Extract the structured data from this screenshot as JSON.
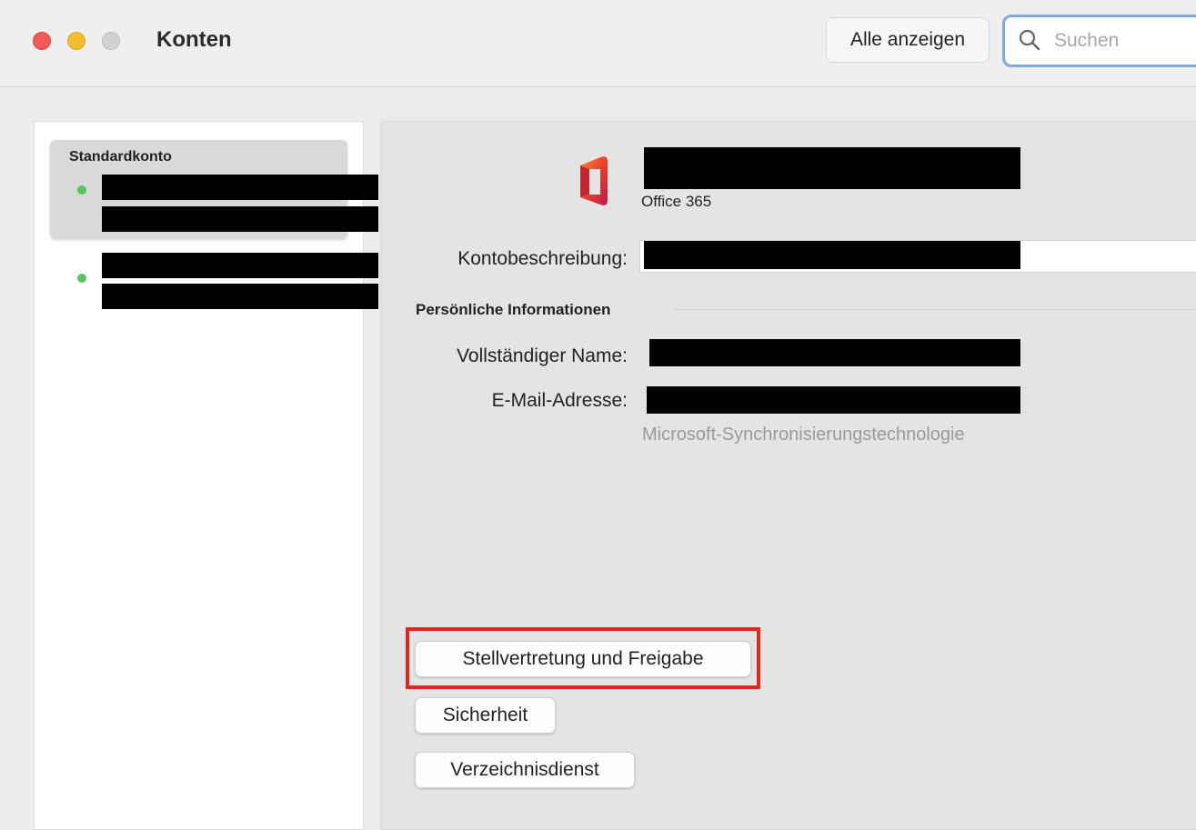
{
  "window": {
    "title": "Konten",
    "show_all_label": "Alle anzeigen",
    "search_placeholder": "Suchen"
  },
  "sidebar": {
    "heading": "Standardkonto",
    "accounts": [
      {
        "status": "online"
      },
      {
        "status": "online"
      }
    ]
  },
  "account": {
    "service_icon": "office-365-logo-icon",
    "type": "Office 365",
    "description_label": "Kontobeschreibung:",
    "section_heading": "Persönliche Informationen",
    "full_name_label": "Vollständiger Name:",
    "email_label": "E-Mail-Adresse:",
    "sync_note": "Microsoft-Synchronisierungstechnologie"
  },
  "buttons": {
    "delegation": "Stellvertretung und Freigabe",
    "security": "Sicherheit",
    "directory": "Verzeichnisdienst"
  },
  "colors": {
    "highlight": "#e0261f",
    "status_online": "#56c55e",
    "focus_ring": "#7fa9de"
  }
}
